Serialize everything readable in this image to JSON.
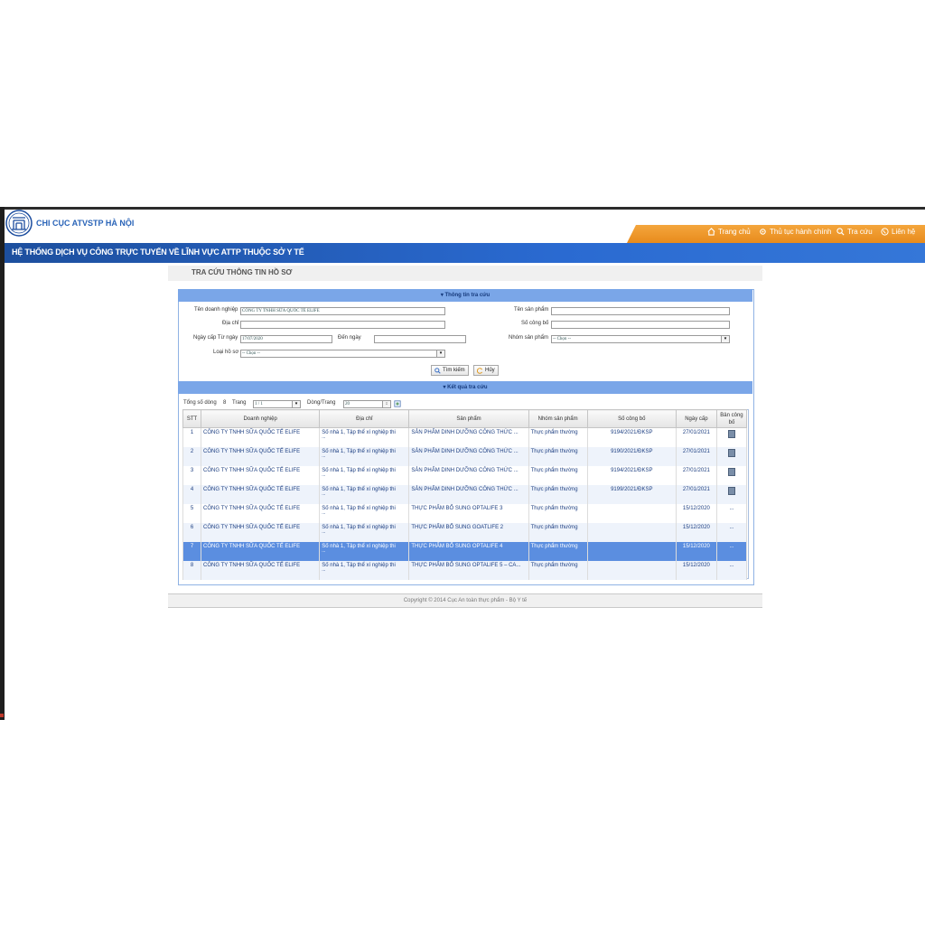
{
  "header": {
    "brand": "CHI CỤC ATVSTP HÀ NỘI",
    "band_title": "HỆ THỐNG DỊCH VỤ CÔNG TRỰC TUYẾN VỀ LĨNH VỰC ATTP THUỘC SỞ Y TẾ",
    "nav": [
      {
        "label": "Trang chủ",
        "icon": "home-icon"
      },
      {
        "label": "Thủ tục hành chính",
        "icon": "gear-icon"
      },
      {
        "label": "Tra cứu",
        "icon": "search-icon"
      },
      {
        "label": "Liên hệ",
        "icon": "phone-icon"
      }
    ],
    "accent_orange": "#f0a030",
    "accent_blue": "#2a6ad1"
  },
  "section": {
    "title": "TRA CỨU THÔNG TIN HỒ SƠ"
  },
  "search": {
    "panel_title": "▾ Thông tin tra cứu",
    "company_label": "Tên doanh nghiệp",
    "company_value": "CÔNG TY TNHH SỮA QUỐC TẾ ELIFE",
    "address_label": "Địa chỉ",
    "address_value": "",
    "date_from_label": "Ngày cấp Từ ngày",
    "date_from_value": "17/07/2020",
    "date_to_label": "Đến ngày",
    "date_to_value": "",
    "record_type_label": "Loại hồ sơ",
    "record_type_value": "-- Chọn --",
    "product_label": "Tên sản phẩm",
    "product_value": "",
    "number_label": "Số công bố",
    "number_value": "",
    "group_label": "Nhóm sản phẩm",
    "group_value": "-- Chọn --",
    "search_btn": "Tìm kiếm",
    "cancel_btn": "Hủy"
  },
  "results": {
    "panel_title": "▾ Kết quả tra cứu",
    "total_label": "Tổng số dòng",
    "total_value": "8",
    "page_label": "Trang",
    "page_value": "1 / 1",
    "per_page_label": "Dòng/Trang",
    "per_page_value": "20",
    "columns": [
      "STT",
      "Doanh nghiệp",
      "Địa chỉ",
      "Sản phẩm",
      "Nhóm sản phẩm",
      "Số công bố",
      "Ngày cấp",
      "Bản công bố"
    ],
    "rows": [
      {
        "stt": "1",
        "company": "CÔNG TY TNHH SỮA QUỐC TẾ ELIFE",
        "address": "Số nhà 1, Tập thể xí nghiệp thi",
        "product": "SẢN PHẨM DINH DƯỠNG CÔNG THỨC ...",
        "group": "Thực phẩm thường",
        "number": "9194/2021/ĐKSP",
        "date": "27/01/2021",
        "doc": "icon"
      },
      {
        "stt": "2",
        "company": "CÔNG TY TNHH SỮA QUỐC TẾ ELIFE",
        "address": "Số nhà 1, Tập thể xí nghiệp thi",
        "product": "SẢN PHẨM DINH DƯỠNG CÔNG THỨC ...",
        "group": "Thực phẩm thường",
        "number": "9190/2021/ĐKSP",
        "date": "27/01/2021",
        "doc": "icon"
      },
      {
        "stt": "3",
        "company": "CÔNG TY TNHH SỮA QUỐC TẾ ELIFE",
        "address": "Số nhà 1, Tập thể xí nghiệp thi",
        "product": "SẢN PHẨM DINH DƯỠNG CÔNG THỨC ...",
        "group": "Thực phẩm thường",
        "number": "9194/2021/ĐKSP",
        "date": "27/01/2021",
        "doc": "icon"
      },
      {
        "stt": "4",
        "company": "CÔNG TY TNHH SỮA QUỐC TẾ ELIFE",
        "address": "Số nhà 1, Tập thể xí nghiệp thi",
        "product": "SẢN PHẨM DINH DƯỠNG CÔNG THỨC ...",
        "group": "Thực phẩm thường",
        "number": "9199/2021/ĐKSP",
        "date": "27/01/2021",
        "doc": "icon"
      },
      {
        "stt": "5",
        "company": "CÔNG TY TNHH SỮA QUỐC TẾ ELIFE",
        "address": "Số nhà 1, Tập thể xí nghiệp thi",
        "product": "THỰC PHẨM BỔ SUNG OPTALIFE 3",
        "group": "Thực phẩm thường",
        "number": "",
        "date": "15/12/2020",
        "doc": "..."
      },
      {
        "stt": "6",
        "company": "CÔNG TY TNHH SỮA QUỐC TẾ ELIFE",
        "address": "Số nhà 1, Tập thể xí nghiệp thi",
        "product": "THỰC PHẨM BỔ SUNG GOATLIFE 2",
        "group": "Thực phẩm thường",
        "number": "",
        "date": "15/12/2020",
        "doc": "..."
      },
      {
        "stt": "7",
        "company": "CÔNG TY TNHH SỮA QUỐC TẾ ELIFE",
        "address": "Số nhà 1, Tập thể xí nghiệp thi",
        "product": "THỰC PHẨM BỔ SUNG OPTALIFE 4",
        "group": "Thực phẩm thường",
        "number": "",
        "date": "15/12/2020",
        "doc": "..."
      },
      {
        "stt": "8",
        "company": "CÔNG TY TNHH SỮA QUỐC TẾ ELIFE",
        "address": "Số nhà 1, Tập thể xí nghiệp thi",
        "product": "THỰC PHẨM BỔ SUNG OPTALIFE 5 – CA...",
        "group": "Thực phẩm thường",
        "number": "",
        "date": "15/12/2020",
        "doc": "..."
      }
    ],
    "selected_row": "7",
    "row_ellipsis": "..."
  },
  "footer": {
    "copyright": "Copyright © 2014 Cục An toàn thực phẩm - Bộ Y tế"
  }
}
